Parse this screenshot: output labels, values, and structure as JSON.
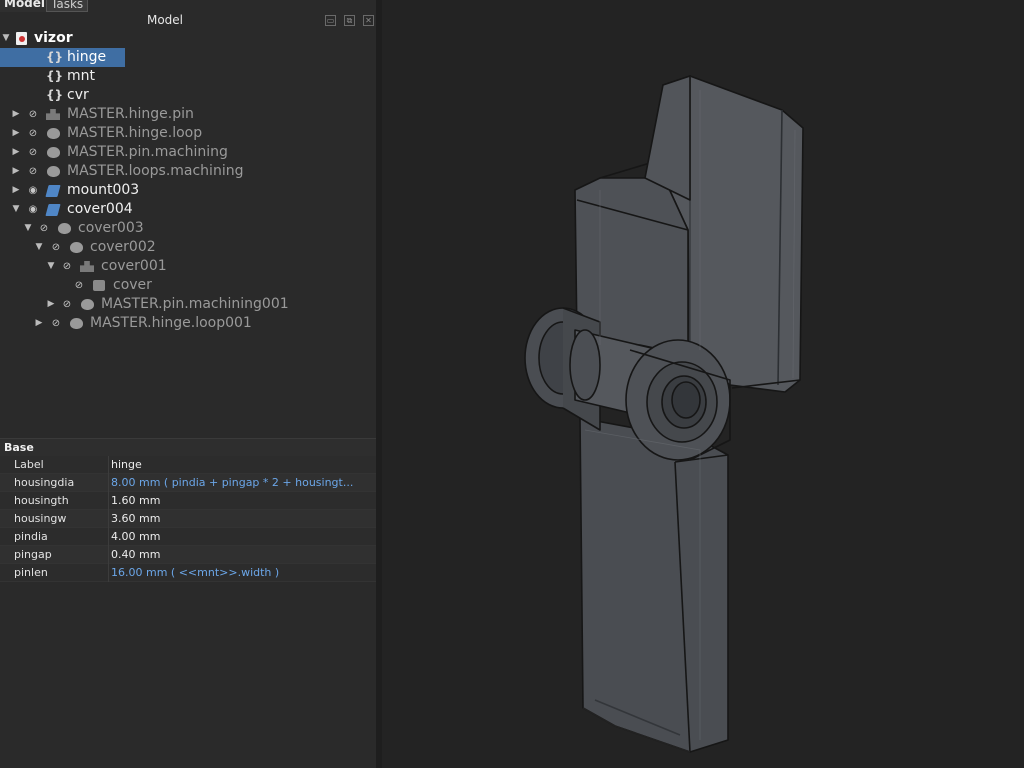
{
  "tabs": {
    "model": "Model",
    "tasks": "Tasks"
  },
  "panel_title": "Model",
  "title_buttons": {
    "minimize": "▭",
    "float": "⧉",
    "close": "✕"
  },
  "tree": [
    {
      "label": "vizor",
      "style": "bold",
      "arrow": "▼",
      "icon": "document-icon"
    },
    {
      "label": "hinge",
      "style": "selected",
      "icon": "spreadsheet-icon"
    },
    {
      "label": "mnt",
      "style": "normal",
      "icon": "spreadsheet-icon"
    },
    {
      "label": "cvr",
      "style": "normal",
      "icon": "spreadsheet-icon"
    },
    {
      "label": "MASTER.hinge.pin",
      "style": "dim",
      "arrow": "▶",
      "icon": "extrude-icon"
    },
    {
      "label": "MASTER.hinge.loop",
      "style": "dim",
      "arrow": "▶",
      "icon": "boolean-icon"
    },
    {
      "label": "MASTER.pin.machining",
      "style": "dim",
      "arrow": "▶",
      "icon": "boolean-icon"
    },
    {
      "label": "MASTER.loops.machining",
      "style": "dim",
      "arrow": "▶",
      "icon": "boolean-icon"
    },
    {
      "label": "mount003",
      "style": "normal",
      "arrow": "▶",
      "icon": "sheet-icon"
    },
    {
      "label": "cover004",
      "style": "normal",
      "arrow": "▼",
      "icon": "sheet-icon"
    },
    {
      "label": "cover003",
      "style": "dim",
      "arrow": "▼",
      "icon": "boolean-icon"
    },
    {
      "label": "cover002",
      "style": "dim",
      "arrow": "▼",
      "icon": "boolean-icon"
    },
    {
      "label": "cover001",
      "style": "dim",
      "arrow": "▼",
      "icon": "extrude-icon"
    },
    {
      "label": "cover",
      "style": "dim",
      "icon": "sketch-icon"
    },
    {
      "label": "MASTER.pin.machining001",
      "style": "dim",
      "arrow": "▶",
      "icon": "boolean-icon"
    },
    {
      "label": "MASTER.hinge.loop001",
      "style": "dim",
      "arrow": "▶",
      "icon": "boolean-icon"
    }
  ],
  "properties": {
    "group": "Base",
    "rows": [
      {
        "name": "Label",
        "value": "hinge",
        "expr": false
      },
      {
        "name": "housingdia",
        "value": "8.00 mm  ( pindia + pingap * 2 + housingt...",
        "expr": true
      },
      {
        "name": "housingth",
        "value": "1.60 mm",
        "expr": false
      },
      {
        "name": "housingw",
        "value": "3.60 mm",
        "expr": false
      },
      {
        "name": "pindia",
        "value": "4.00 mm",
        "expr": false
      },
      {
        "name": "pingap",
        "value": "0.40 mm",
        "expr": false
      },
      {
        "name": "pinlen",
        "value": "16.00 mm  ( <<mnt>>.width )",
        "expr": true
      }
    ]
  },
  "colors": {
    "selection": "#3f6ea3",
    "expression": "#6ba6e8",
    "viewport_bg": "#232323"
  }
}
